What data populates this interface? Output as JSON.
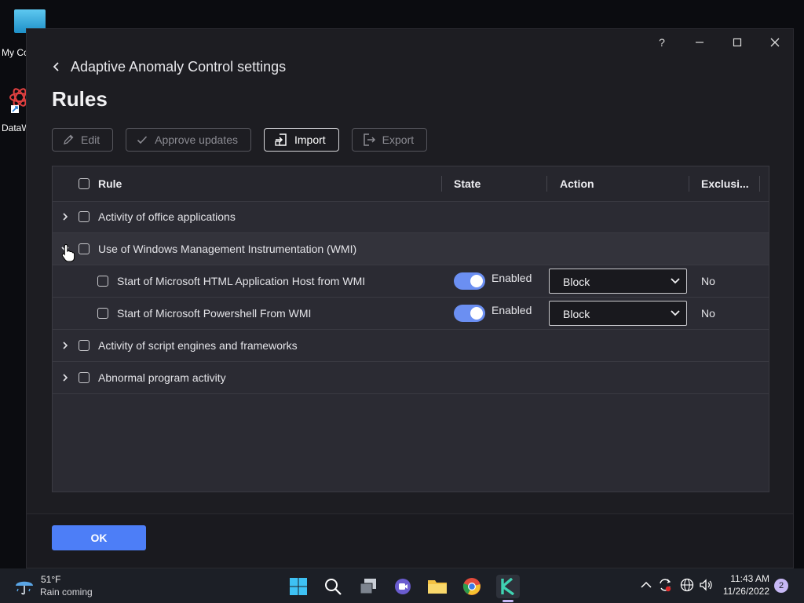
{
  "desktop": {
    "icons": [
      {
        "label": "My Computer",
        "icon": "monitor-icon"
      },
      {
        "label": "DataWorks",
        "icon": "datawiz-icon"
      }
    ]
  },
  "window": {
    "titlebar": {
      "help": "?"
    },
    "breadcrumb": "Adaptive Anomaly Control settings",
    "title": "Rules",
    "toolbar": {
      "edit": "Edit",
      "approve": "Approve updates",
      "import": "Import",
      "export": "Export"
    },
    "table": {
      "columns": {
        "rule": "Rule",
        "state": "State",
        "action": "Action",
        "exclusions": "Exclusi..."
      },
      "groups": [
        {
          "label": "Activity of office applications",
          "expanded": false
        },
        {
          "label": "Use of Windows Management Instrumentation (WMI)",
          "expanded": true,
          "children": [
            {
              "label": "Start of Microsoft HTML Application Host from WMI",
              "state": "Enabled",
              "action": "Block",
              "exclusions": "No"
            },
            {
              "label": "Start of Microsoft Powershell From WMI",
              "state": "Enabled",
              "action": "Block",
              "exclusions": "No"
            }
          ]
        },
        {
          "label": "Activity of script engines and frameworks",
          "expanded": false
        },
        {
          "label": "Abnormal program activity",
          "expanded": false
        }
      ]
    },
    "footer": {
      "ok": "OK"
    }
  },
  "taskbar": {
    "weather": {
      "temp": "51°F",
      "desc": "Rain coming"
    },
    "clock": {
      "time": "11:43 AM",
      "date": "11/26/2022"
    },
    "notifications": "2",
    "accent": "#4d7ef7",
    "toggle_color": "#6b8ff2"
  }
}
